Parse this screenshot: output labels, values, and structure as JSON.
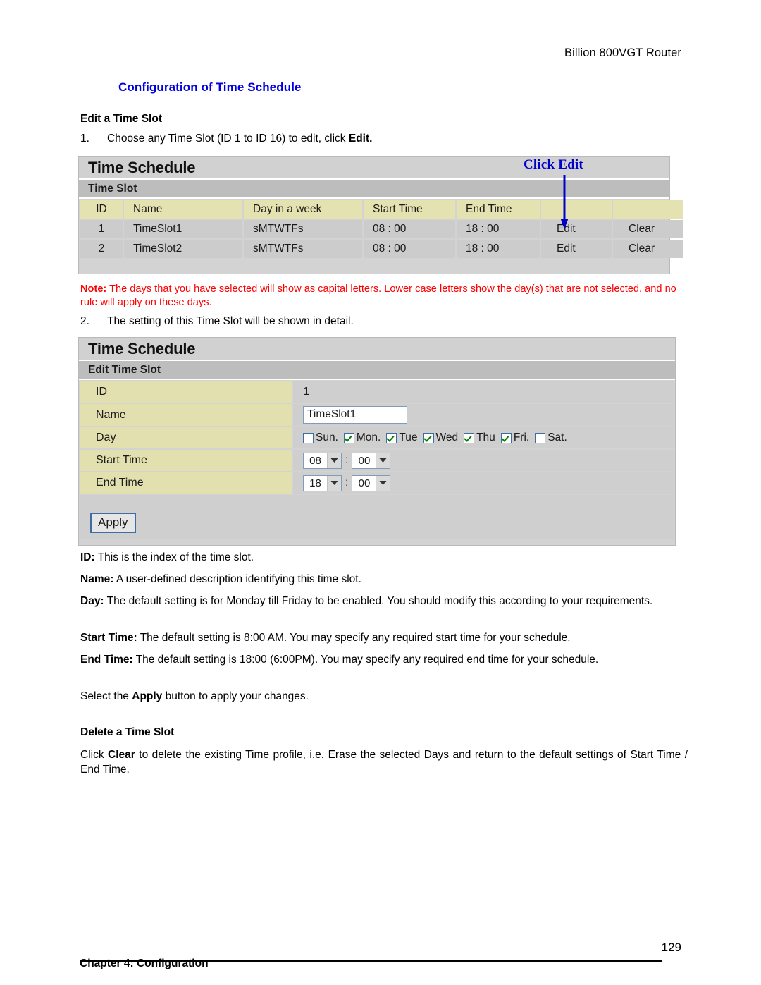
{
  "document": {
    "running_header": "Billion 800VGT Router",
    "section_title": "Configuration of Time Schedule",
    "sub_heading_edit": "Edit a Time Slot",
    "sub_heading_delete": "Delete a Time Slot",
    "step_1_num": "1.",
    "step_1_text_a": "Choose any Time Slot (ID 1 to ID 16) to edit, click ",
    "step_1_bold": "Edit.",
    "step_2_num": "2.",
    "step_2_text": "The setting of this Time Slot will be shown in detail.",
    "note_label": "Note:",
    "note_text": "  The days that you have selected will show as capital letters. Lower case letters show the day(s) that are not selected, and no rule will apply on these days.",
    "note_color": "#ff0000",
    "heading_color": "#0000e0"
  },
  "callout": {
    "label": "Click Edit",
    "color": "#0000cd"
  },
  "screenshot_list": {
    "title": "Time Schedule",
    "subtitle": "Time Slot",
    "columns": [
      "ID",
      "Name",
      "Day in a week",
      "Start Time",
      "End Time",
      "",
      ""
    ],
    "rows": [
      {
        "id": "1",
        "name": "TimeSlot1",
        "day": "sMTWTFs",
        "start_time": "08 : 00",
        "end_time": "18 : 00",
        "edit": "Edit",
        "clear": "Clear"
      },
      {
        "id": "2",
        "name": "TimeSlot2",
        "day": "sMTWTFs",
        "start_time": "08 : 00",
        "end_time": "18 : 00",
        "edit": "Edit",
        "clear": "Clear"
      }
    ],
    "link_color": "#6b9fd4",
    "header_bg": "#e5e2b2",
    "row_bg": "#cccccc"
  },
  "screenshot_edit": {
    "title": "Time Schedule",
    "subtitle": "Edit Time Slot",
    "labels": {
      "id": "ID",
      "name": "Name",
      "day": "Day",
      "start_time": "Start Time",
      "end_time": "End Time"
    },
    "values": {
      "id": "1",
      "name": "TimeSlot1",
      "start_hour": "08",
      "start_minute": "00",
      "end_hour": "18",
      "end_minute": "00"
    },
    "days": [
      {
        "label": "Sun.",
        "checked": false
      },
      {
        "label": "Mon.",
        "checked": true
      },
      {
        "label": "Tue",
        "checked": true
      },
      {
        "label": "Wed",
        "checked": true
      },
      {
        "label": "Thu",
        "checked": true
      },
      {
        "label": "Fri.",
        "checked": true
      },
      {
        "label": "Sat.",
        "checked": false
      }
    ],
    "apply_label": "Apply",
    "label_bg": "#e3e0b0",
    "value_bg": "#cfcfcf",
    "checkmark_color": "#008000"
  },
  "descriptions": {
    "id_label": "ID:",
    "id_text": "  This is the index of the time slot.",
    "name_label": "Name:",
    "name_text": " A user-defined description identifying this time slot.",
    "day_label": "Day:",
    "day_text": " The default setting is for Monday till Friday to be enabled.   You should modify this according to your requirements.",
    "start_label": "Start Time:",
    "start_text": " The default setting is 8:00 AM.   You may specify any required start time for your schedule.",
    "end_label": "End Time:",
    "end_text": " The default setting is 18:00 (6:00PM).   You may specify any required end time for your schedule.",
    "apply_pre": "Select the ",
    "apply_bold": "Apply",
    "apply_post": " button to apply your changes.",
    "delete_pre": "Click ",
    "delete_bold": "Clear",
    "delete_post": " to delete the existing Time profile, i.e. Erase the selected Days and return to the default settings of Start Time / End Time."
  },
  "footer": {
    "page_number": "129",
    "chapter_label": "Chapter 4: Configuration"
  }
}
